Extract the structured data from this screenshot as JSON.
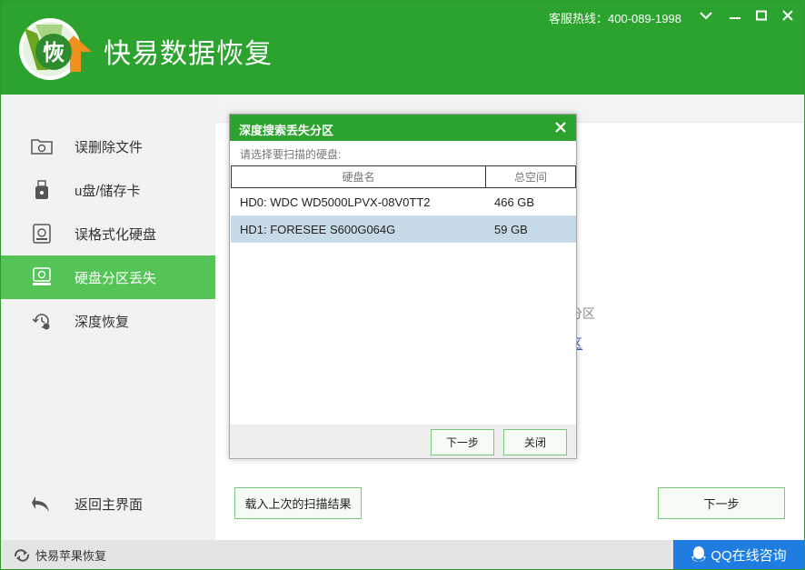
{
  "app": {
    "title": "快易数据恢复",
    "logo_char": "恢",
    "hotline": "客服热线：400-089-1998"
  },
  "window_controls": {
    "dropdown_icon": "chevron-down-icon",
    "minimize_icon": "minimize-icon",
    "maximize_icon": "maximize-icon",
    "close_icon": "close-icon"
  },
  "sidebar": {
    "items": [
      {
        "label": "误删除文件",
        "icon": "folder-icon"
      },
      {
        "label": "u盘/储存卡",
        "icon": "usb-icon"
      },
      {
        "label": "误格式化硬盘",
        "icon": "disk-icon"
      },
      {
        "label": "硬盘分区丢失",
        "icon": "partition-icon"
      },
      {
        "label": "深度恢复",
        "icon": "history-icon"
      }
    ],
    "active_index": 3,
    "back_label": "返回主界面"
  },
  "main": {
    "bg_text_partial": "分区",
    "bg_link_partial": "区",
    "load_last_label": "载入上次的扫描结果",
    "next_label": "下一步"
  },
  "dialog": {
    "title": "深度搜索丢失分区",
    "prompt": "请选择要扫描的硬盘:",
    "columns": [
      "硬盘名",
      "总空间"
    ],
    "rows": [
      {
        "name": "HD0: WDC WD5000LPVX-08V0TT2",
        "size": "466 GB"
      },
      {
        "name": "HD1: FORESEE S600G064G",
        "size": "59 GB"
      }
    ],
    "selected_row": 1,
    "next_label": "下一步",
    "close_label": "关闭"
  },
  "footer": {
    "apple_label": "快易苹果恢复",
    "qq_label": "QQ在线咨询"
  },
  "colors": {
    "brand_green": "#2ca32e",
    "active_green": "#54c456",
    "qq_blue": "#1f7ce0",
    "selected_row": "#c6dbe7"
  }
}
